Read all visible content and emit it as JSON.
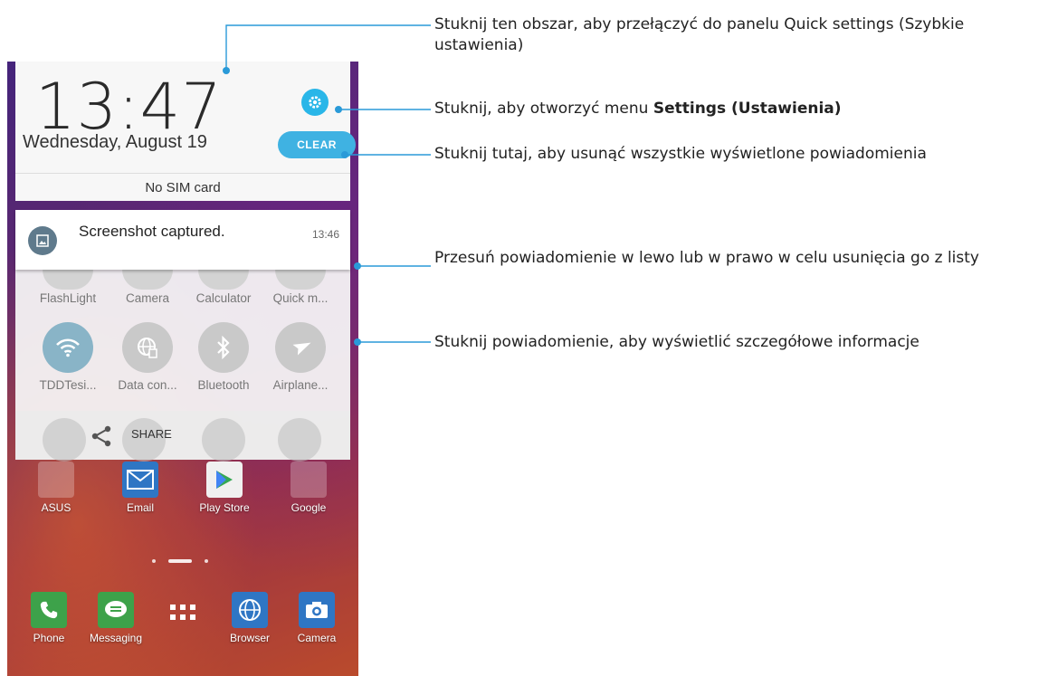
{
  "status": {
    "clock": "13:47",
    "date": "Wednesday, August 19",
    "clear_label": "CLEAR",
    "sim_text": "No SIM card"
  },
  "notification": {
    "title": "Screenshot captured.",
    "time": "13:46"
  },
  "quick_settings": {
    "row1": [
      "FlashLight",
      "Camera",
      "Calculator",
      "Quick m..."
    ],
    "row2": [
      {
        "label": "TDDTesi...",
        "icon": "wifi-icon",
        "active": true
      },
      {
        "label": "Data con...",
        "icon": "data-connection-icon",
        "active": false
      },
      {
        "label": "Bluetooth",
        "icon": "bluetooth-icon",
        "active": false
      },
      {
        "label": "Airplane...",
        "icon": "airplane-icon",
        "active": false
      }
    ],
    "share_label": "SHARE"
  },
  "home": {
    "row1": [
      "ASUS",
      "Email",
      "Play Store",
      "Google"
    ],
    "dock": [
      "Phone",
      "Messaging",
      "",
      "Browser",
      "Camera"
    ]
  },
  "callouts": {
    "quick_settings": "Stuknij ten obszar, aby przełączyć do panelu Quick settings (Szybkie ustawienia)",
    "settings_prefix": "Stuknij, aby otworzyć menu ",
    "settings_bold": "Settings (Ustawienia)",
    "clear": "Stuknij tutaj, aby usunąć wszystkie wyświetlone powiadomienia",
    "swipe": "Przesuń powiadomienie w lewo lub w prawo w celu usunięcia go z listy",
    "tap": "Stuknij powiadomienie, aby wyświetlić szczegółowe informacje"
  },
  "colors": {
    "accent": "#29b6e8",
    "callout_line": "#2a9ad8"
  }
}
